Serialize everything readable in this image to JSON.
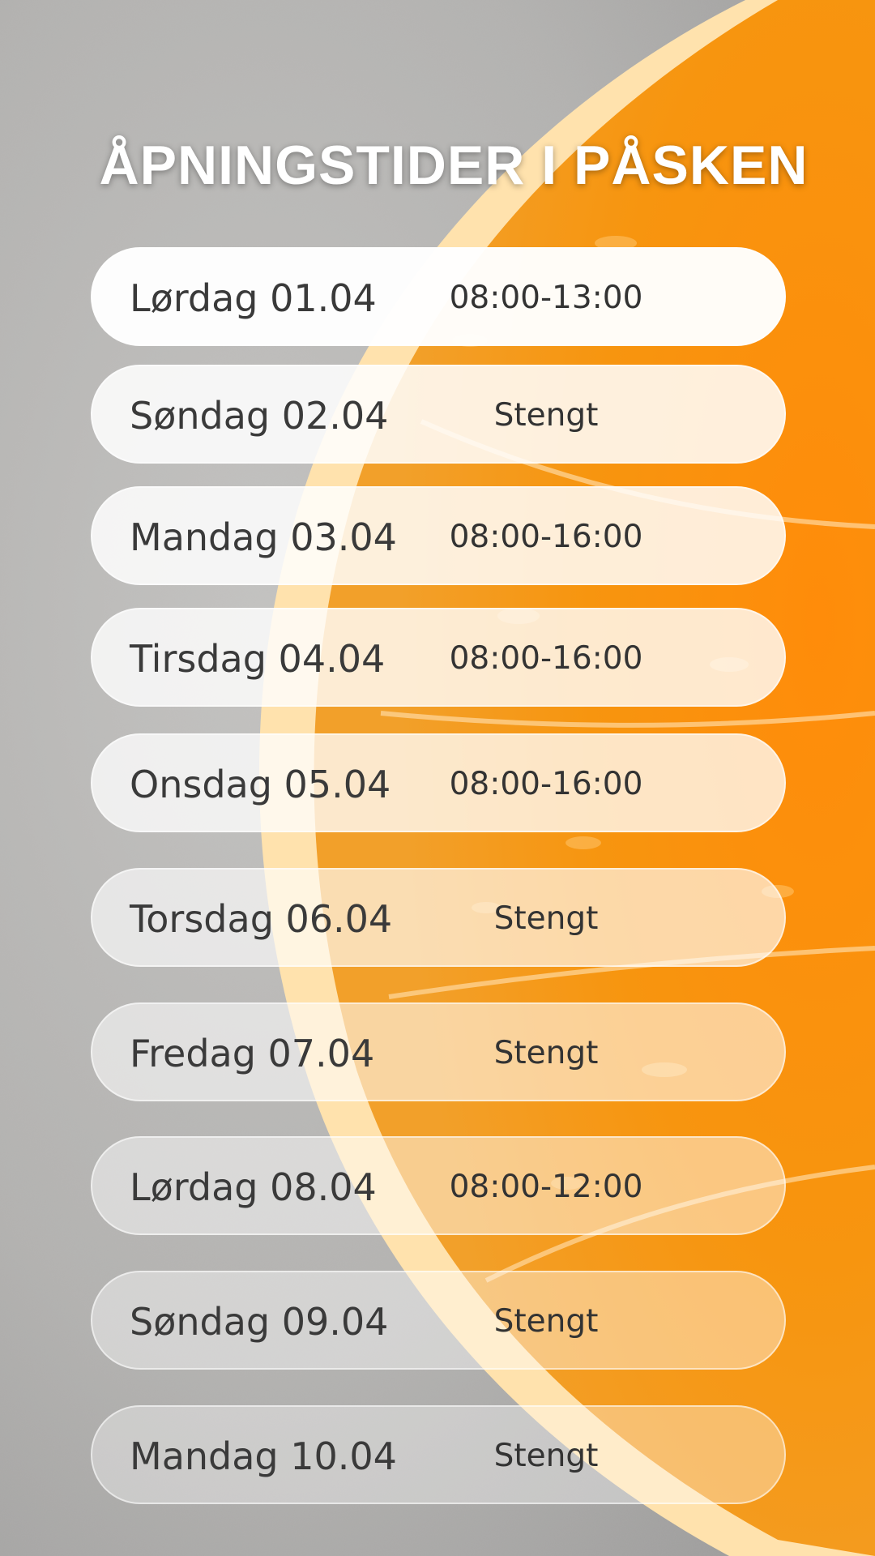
{
  "title": "ÅPNINGSTIDER I PÅSKEN",
  "colors": {
    "stone": "#b9b8b6",
    "orange": "#f58a14",
    "pith": "#ffe6b8",
    "text": "#333333"
  },
  "schedule": [
    {
      "day": "Lørdag 01.04",
      "hours": "08:00-13:00"
    },
    {
      "day": "Søndag 02.04",
      "hours": "Stengt"
    },
    {
      "day": "Mandag 03.04",
      "hours": "08:00-16:00"
    },
    {
      "day": "Tirsdag 04.04",
      "hours": "08:00-16:00"
    },
    {
      "day": "Onsdag 05.04",
      "hours": "08:00-16:00"
    },
    {
      "day": "Torsdag 06.04",
      "hours": "Stengt"
    },
    {
      "day": "Fredag 07.04",
      "hours": "Stengt"
    },
    {
      "day": "Lørdag 08.04",
      "hours": "08:00-12:00"
    },
    {
      "day": "Søndag 09.04",
      "hours": "Stengt"
    },
    {
      "day": "Mandag 10.04",
      "hours": "Stengt"
    }
  ]
}
